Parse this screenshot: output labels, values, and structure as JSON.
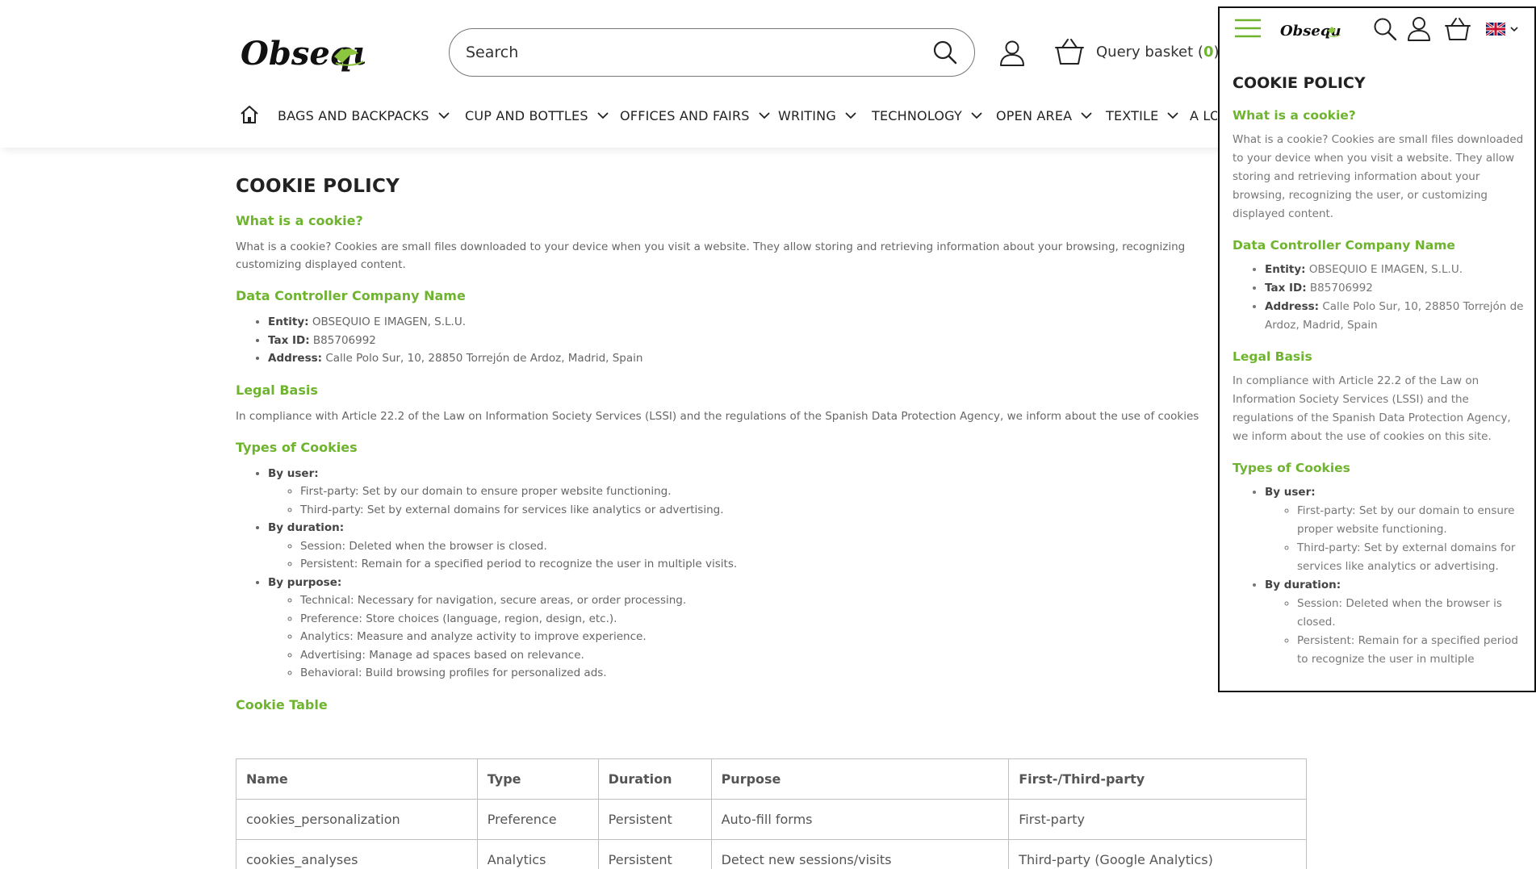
{
  "header": {
    "logo_text": "Obsequio",
    "search": {
      "placeholder": "Search",
      "value": ""
    },
    "basket": {
      "label": "Query basket",
      "open": "(",
      "count": "0",
      "close": ")"
    }
  },
  "nav": {
    "items": [
      {
        "label": "BAGS AND BACKPACKS"
      },
      {
        "label": "CUP AND BOTTLES"
      },
      {
        "label": "OFFICES AND FAIRS"
      },
      {
        "label": "WRITING"
      },
      {
        "label": "TECHNOLOGY"
      },
      {
        "label": "OPEN AREA"
      },
      {
        "label": "TEXTILE"
      },
      {
        "label": "A LO"
      }
    ]
  },
  "page": {
    "title": "COOKIE POLICY",
    "what_heading": "What is a cookie?",
    "what_text_line1": "What is a cookie? Cookies are small files downloaded to your device when you visit a website. They allow storing and retrieving information about your browsing, recognizing",
    "what_text_line2": "customizing displayed content.",
    "controller_heading": "Data Controller Company Name",
    "controller": {
      "entity_label": "Entity:",
      "entity_value": " OBSEQUIO E IMAGEN, S.L.U.",
      "tax_label": "Tax ID:",
      "tax_value": " B85706992",
      "address_label": "Address:",
      "address_value": " Calle Polo Sur, 10, 28850 Torrejón de Ardoz, Madrid, Spain"
    },
    "legal_heading": "Legal Basis",
    "legal_text": "In compliance with Article 22.2 of the Law on Information Society Services (LSSI) and the regulations of the Spanish Data Protection Agency, we inform about the use of cookies",
    "types_heading": "Types of Cookies",
    "types": {
      "by_user": "By user:",
      "first_party": "First-party: Set by our domain to ensure proper website functioning.",
      "third_party": "Third-party: Set by external domains for services like analytics or advertising.",
      "by_duration": "By duration:",
      "session": "Session: Deleted when the browser is closed.",
      "persistent": "Persistent: Remain for a specified period to recognize the user in multiple visits.",
      "by_purpose": "By purpose:",
      "technical": "Technical: Necessary for navigation, secure areas, or order processing.",
      "preference": "Preference: Store choices (language, region, design, etc.).",
      "analytics": "Analytics: Measure and analyze activity to improve experience.",
      "advertising": "Advertising: Manage ad spaces based on relevance.",
      "behavioral": "Behavioral: Build browsing profiles for personalized ads."
    },
    "table_heading": "Cookie Table",
    "table": {
      "headers": [
        "Name",
        "Type",
        "Duration",
        "Purpose",
        "First-/Third-party"
      ],
      "rows": [
        [
          "cookies_personalization",
          "Preference",
          "Persistent",
          "Auto-fill forms",
          "First-party"
        ],
        [
          "cookies_analyses",
          "Analytics",
          "Persistent",
          "Detect new sessions/visits",
          "Third-party (Google Analytics)"
        ]
      ]
    }
  },
  "mobile": {
    "logo_text": "Obsequio",
    "title": "COOKIE POLICY",
    "what_heading": "What is a cookie?",
    "what_text": "What is a cookie? Cookies are small files downloaded to your device when you visit a website. They allow storing and retrieving information about your browsing, recognizing the user, or customizing displayed content.",
    "controller_heading": "Data Controller Company Name",
    "entity_label": "Entity:",
    "entity_value": " OBSEQUIO E IMAGEN, S.L.U.",
    "tax_label": "Tax ID:",
    "tax_value": " B85706992",
    "address_label": "Address:",
    "address_value": " Calle Polo Sur, 10, 28850 Torrejón de Ardoz, Madrid, Spain",
    "legal_heading": "Legal Basis",
    "legal_text": "In compliance with Article 22.2 of the Law on Information Society Services (LSSI) and the regulations of the Spanish Data Protection Agency, we inform about the use of cookies on this site.",
    "types_heading": "Types of Cookies",
    "by_user": "By user:",
    "first_party": "First-party: Set by our domain to ensure proper website functioning.",
    "third_party": "Third-party: Set by external domains for services like analytics or advertising.",
    "by_duration": "By duration:",
    "session": "Session: Deleted when the browser is closed.",
    "persistent": "Persistent: Remain for a specified period to recognize the user in multiple"
  },
  "colors": {
    "accent": "#6eb42e",
    "heading": "#222222",
    "text": "#666666"
  }
}
